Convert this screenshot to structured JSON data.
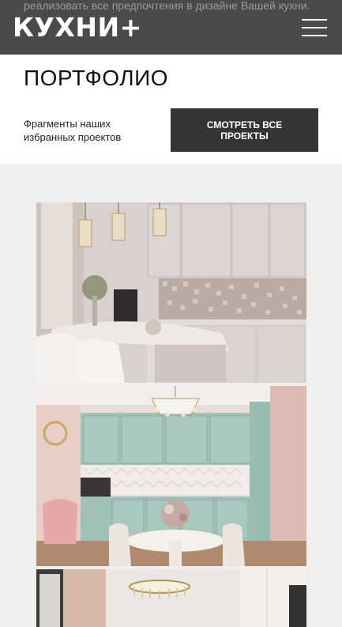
{
  "header": {
    "behind_text": "реализовать все предпочтения в дизайне Вашей кухни.",
    "logo": "КУХНИ+",
    "menu_icon": "hamburger-menu-icon"
  },
  "portfolio": {
    "title": "ПОРТФОЛИО",
    "subtitle": "Фрагменты наших избранных проектов",
    "button_label": "СМОТРЕТЬ ВСЕ ПРОЕКТЫ"
  },
  "colors": {
    "header_bg": "#4a4a4a",
    "button_bg": "#353535",
    "page_bg": "#efefef"
  }
}
